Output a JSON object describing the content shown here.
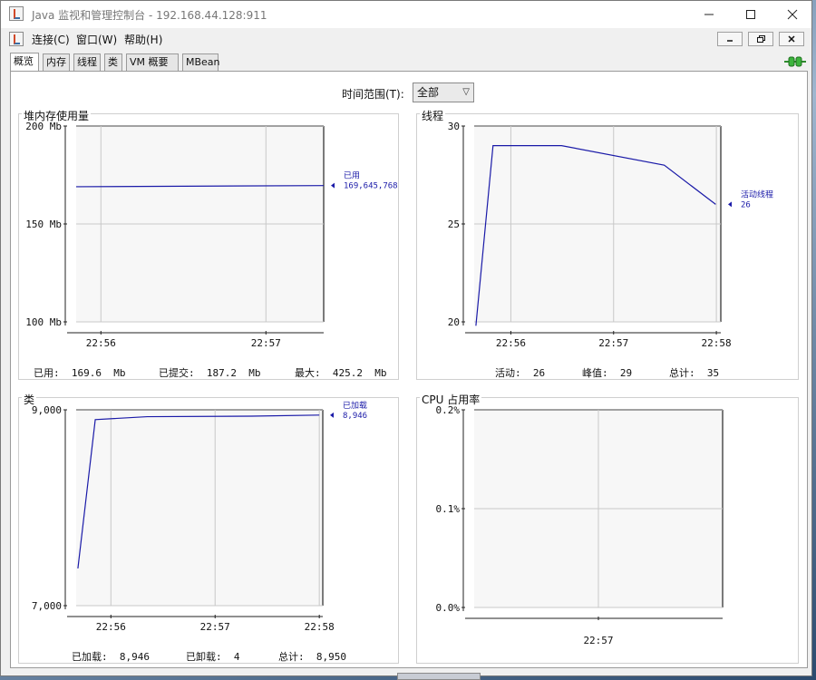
{
  "window": {
    "title": "Java 监视和管理控制台 - 192.168.44.128:911"
  },
  "menu": [
    "连接(C)",
    "窗口(W)",
    "帮助(H)"
  ],
  "tabs": [
    "概览",
    "内存",
    "线程",
    "类",
    "VM 概要",
    "MBean"
  ],
  "time_range": {
    "label": "时间范围(T):",
    "value": "全部"
  },
  "panels": {
    "heap": {
      "title": "堆内存使用量",
      "stats": [
        "已用:  169.6  Mb",
        "已提交:  187.2  Mb",
        "最大:  425.2  Mb"
      ]
    },
    "threads": {
      "title": "线程",
      "stats": [
        "活动:  26",
        "峰值:  29",
        "总计:  35"
      ]
    },
    "classes": {
      "title": "类",
      "stats": [
        "已加载:  8,946",
        "已卸载:  4",
        "总计:  8,950"
      ]
    },
    "cpu": {
      "title": "CPU 占用率"
    }
  },
  "colors": {
    "series": "#1a1aa8",
    "grid": "#c8c8c8",
    "plot_bg": "#f7f7f7"
  },
  "chart_data": [
    {
      "id": "heap",
      "type": "line",
      "ytick_labels": [
        "100 Mb",
        "150 Mb",
        "200 Mb"
      ],
      "yticks": [
        100,
        150,
        200
      ],
      "ylim": [
        100,
        200
      ],
      "xtick_labels": [
        "22:56",
        "22:57"
      ],
      "xticks": [
        0.6,
        4.6
      ],
      "xlim": [
        0,
        6.0
      ],
      "series": [
        {
          "name": "已用",
          "value_label": "169,645,768",
          "x": [
            0,
            6.0
          ],
          "y": [
            169,
            169.6
          ]
        }
      ]
    },
    {
      "id": "threads",
      "type": "line",
      "ytick_labels": [
        "20",
        "25",
        "30"
      ],
      "yticks": [
        20,
        25,
        30
      ],
      "ylim": [
        20,
        30
      ],
      "xtick_labels": [
        "22:56",
        "22:57",
        "22:58"
      ],
      "xticks": [
        1.07,
        4.07,
        7.07
      ],
      "xlim": [
        0,
        7.2
      ],
      "series": [
        {
          "name": "活动线程",
          "value_label": "26",
          "x": [
            0.05,
            0.55,
            2.55,
            5.55,
            7.05
          ],
          "y": [
            19.8,
            29.0,
            29.0,
            28.0,
            26.0
          ]
        }
      ]
    },
    {
      "id": "classes",
      "type": "line",
      "ytick_labels": [
        "7,000",
        "9,000"
      ],
      "yticks": [
        7000,
        9000
      ],
      "ylim": [
        7000,
        9000
      ],
      "xtick_labels": [
        "22:56",
        "22:57",
        "22:58"
      ],
      "xticks": [
        1.0,
        4.0,
        7.0
      ],
      "xlim": [
        0,
        7.1
      ],
      "series": [
        {
          "name": "已加载",
          "value_label": "8,946",
          "x": [
            0.05,
            0.55,
            2.05,
            5.05,
            7.0
          ],
          "y": [
            7380,
            8900,
            8930,
            8935,
            8946
          ]
        }
      ]
    },
    {
      "id": "cpu",
      "type": "line",
      "ytick_labels": [
        "0.0%",
        "0.1%",
        "0.2%"
      ],
      "yticks": [
        0.0,
        0.1,
        0.2
      ],
      "ylim": [
        0.0,
        0.2
      ],
      "xtick_labels": [
        "22:57"
      ],
      "xticks": [
        2.0
      ],
      "xlim": [
        0,
        4.0
      ],
      "series": []
    }
  ]
}
